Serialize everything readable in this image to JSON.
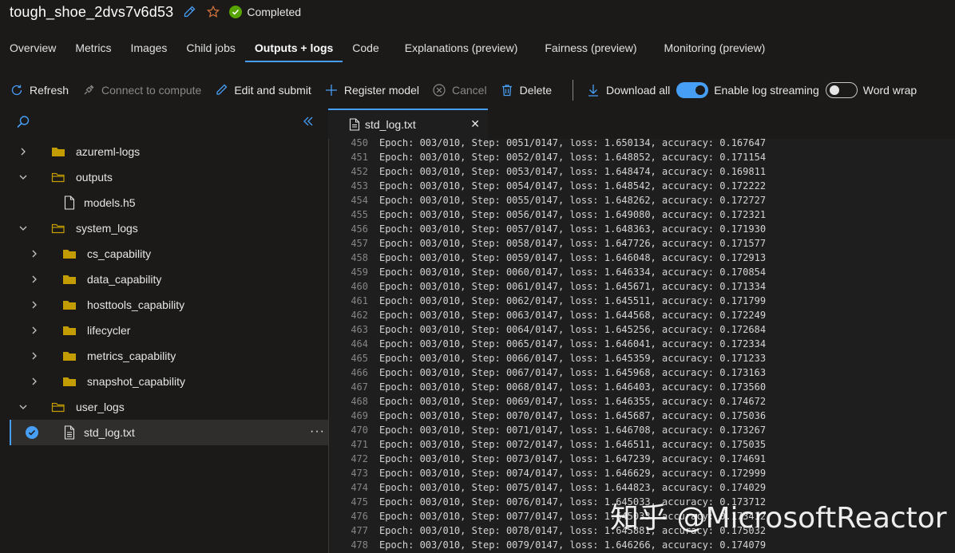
{
  "header": {
    "job_name": "tough_shoe_2dvs7v6d53",
    "status": "Completed"
  },
  "tabs": [
    {
      "label": "Overview",
      "active": false
    },
    {
      "label": "Metrics",
      "active": false
    },
    {
      "label": "Images",
      "active": false
    },
    {
      "label": "Child jobs",
      "active": false
    },
    {
      "label": "Outputs + logs",
      "active": true
    },
    {
      "label": "Code",
      "active": false
    },
    {
      "label": "Explanations (preview)",
      "active": false
    },
    {
      "label": "Fairness (preview)",
      "active": false
    },
    {
      "label": "Monitoring (preview)",
      "active": false
    }
  ],
  "toolbar": {
    "refresh": "Refresh",
    "connect": "Connect to compute",
    "edit_submit": "Edit and submit",
    "register_model": "Register model",
    "cancel": "Cancel",
    "delete": "Delete",
    "download_all": "Download all",
    "enable_log_streaming": "Enable log streaming",
    "enable_log_streaming_on": true,
    "word_wrap": "Word wrap",
    "word_wrap_on": false
  },
  "tree": {
    "items": [
      {
        "label": "azureml-logs",
        "type": "folder",
        "expanded": false,
        "depth": 0
      },
      {
        "label": "outputs",
        "type": "folder",
        "expanded": true,
        "depth": 0
      },
      {
        "label": "models.h5",
        "type": "file",
        "depth": 1
      },
      {
        "label": "system_logs",
        "type": "folder",
        "expanded": true,
        "depth": 0
      },
      {
        "label": "cs_capability",
        "type": "folder",
        "expanded": false,
        "depth": 1
      },
      {
        "label": "data_capability",
        "type": "folder",
        "expanded": false,
        "depth": 1
      },
      {
        "label": "hosttools_capability",
        "type": "folder",
        "expanded": false,
        "depth": 1
      },
      {
        "label": "lifecycler",
        "type": "folder",
        "expanded": false,
        "depth": 1
      },
      {
        "label": "metrics_capability",
        "type": "folder",
        "expanded": false,
        "depth": 1
      },
      {
        "label": "snapshot_capability",
        "type": "folder",
        "expanded": false,
        "depth": 1
      },
      {
        "label": "user_logs",
        "type": "folder",
        "expanded": true,
        "depth": 0
      },
      {
        "label": "std_log.txt",
        "type": "file",
        "depth": 1,
        "selected": true
      }
    ]
  },
  "file_tab": {
    "name": "std_log.txt"
  },
  "log": {
    "lines": [
      {
        "n": "450",
        "text": "Epoch: 003/010, Step: 0051/0147, loss: 1.650134, accuracy: 0.167647"
      },
      {
        "n": "451",
        "text": "Epoch: 003/010, Step: 0052/0147, loss: 1.648852, accuracy: 0.171154"
      },
      {
        "n": "452",
        "text": "Epoch: 003/010, Step: 0053/0147, loss: 1.648474, accuracy: 0.169811"
      },
      {
        "n": "453",
        "text": "Epoch: 003/010, Step: 0054/0147, loss: 1.648542, accuracy: 0.172222"
      },
      {
        "n": "454",
        "text": "Epoch: 003/010, Step: 0055/0147, loss: 1.648262, accuracy: 0.172727"
      },
      {
        "n": "455",
        "text": "Epoch: 003/010, Step: 0056/0147, loss: 1.649080, accuracy: 0.172321"
      },
      {
        "n": "456",
        "text": "Epoch: 003/010, Step: 0057/0147, loss: 1.648363, accuracy: 0.171930"
      },
      {
        "n": "457",
        "text": "Epoch: 003/010, Step: 0058/0147, loss: 1.647726, accuracy: 0.171577"
      },
      {
        "n": "458",
        "text": "Epoch: 003/010, Step: 0059/0147, loss: 1.646048, accuracy: 0.172913"
      },
      {
        "n": "459",
        "text": "Epoch: 003/010, Step: 0060/0147, loss: 1.646334, accuracy: 0.170854"
      },
      {
        "n": "460",
        "text": "Epoch: 003/010, Step: 0061/0147, loss: 1.645671, accuracy: 0.171334"
      },
      {
        "n": "461",
        "text": "Epoch: 003/010, Step: 0062/0147, loss: 1.645511, accuracy: 0.171799"
      },
      {
        "n": "462",
        "text": "Epoch: 003/010, Step: 0063/0147, loss: 1.644568, accuracy: 0.172249"
      },
      {
        "n": "463",
        "text": "Epoch: 003/010, Step: 0064/0147, loss: 1.645256, accuracy: 0.172684"
      },
      {
        "n": "464",
        "text": "Epoch: 003/010, Step: 0065/0147, loss: 1.646041, accuracy: 0.172334"
      },
      {
        "n": "465",
        "text": "Epoch: 003/010, Step: 0066/0147, loss: 1.645359, accuracy: 0.171233"
      },
      {
        "n": "466",
        "text": "Epoch: 003/010, Step: 0067/0147, loss: 1.645968, accuracy: 0.173163"
      },
      {
        "n": "467",
        "text": "Epoch: 003/010, Step: 0068/0147, loss: 1.646403, accuracy: 0.173560"
      },
      {
        "n": "468",
        "text": "Epoch: 003/010, Step: 0069/0147, loss: 1.646355, accuracy: 0.174672"
      },
      {
        "n": "469",
        "text": "Epoch: 003/010, Step: 0070/0147, loss: 1.645687, accuracy: 0.175036"
      },
      {
        "n": "470",
        "text": "Epoch: 003/010, Step: 0071/0147, loss: 1.646708, accuracy: 0.173267"
      },
      {
        "n": "471",
        "text": "Epoch: 003/010, Step: 0072/0147, loss: 1.646511, accuracy: 0.175035"
      },
      {
        "n": "472",
        "text": "Epoch: 003/010, Step: 0073/0147, loss: 1.647239, accuracy: 0.174691"
      },
      {
        "n": "473",
        "text": "Epoch: 003/010, Step: 0074/0147, loss: 1.646629, accuracy: 0.172999"
      },
      {
        "n": "474",
        "text": "Epoch: 003/010, Step: 0075/0147, loss: 1.644823, accuracy: 0.174029"
      },
      {
        "n": "475",
        "text": "Epoch: 003/010, Step: 0076/0147, loss: 1.645033, accuracy: 0.173712"
      },
      {
        "n": "476",
        "text": "Epoch: 003/010, Step: 0077/0147, loss: 1.645033, accuracy: 0.173412"
      },
      {
        "n": "477",
        "text": "Epoch: 003/010, Step: 0078/0147, loss: 1.645881, accuracy: 0.175032"
      },
      {
        "n": "478",
        "text": "Epoch: 003/010, Step: 0079/0147, loss: 1.646266, accuracy: 0.174079"
      }
    ]
  },
  "watermark": "知乎 @MicrosoftReactor",
  "colors": {
    "accent": "#479ef5",
    "status_success": "#57a300",
    "folder": "#c29c00",
    "star": "#d9773c"
  },
  "icons": {
    "edit": "pencil-icon",
    "favorite": "star-icon",
    "status": "check-circle-icon",
    "refresh": "refresh-icon",
    "connect": "plug-icon",
    "register": "plus-icon",
    "cancel": "cancel-circle-icon",
    "delete": "trash-icon",
    "download": "download-icon",
    "search": "search-icon",
    "collapse": "double-chevron-left-icon",
    "folder": "folder-icon",
    "file": "file-icon"
  }
}
